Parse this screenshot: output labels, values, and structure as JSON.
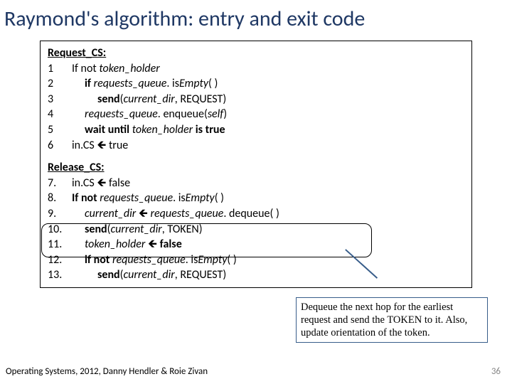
{
  "title": "Raymond's algorithm: entry and exit code",
  "request": {
    "header": "Request_CS:",
    "lines": [
      {
        "num": "1",
        "indent": 1,
        "parts": [
          "If not ",
          [
            "it",
            "token_holder"
          ]
        ]
      },
      {
        "num": "2",
        "indent": 2,
        "parts": [
          [
            "b",
            "if "
          ],
          [
            "it",
            "requests_queue"
          ],
          [
            ".",
            "is"
          ],
          [
            "it",
            "Empty"
          ],
          "( )"
        ]
      },
      {
        "num": "3",
        "indent": 3,
        "parts": [
          [
            "b",
            "send"
          ],
          "(",
          [
            "it",
            "current_dir"
          ],
          ", REQUEST)"
        ]
      },
      {
        "num": "4",
        "indent": 2,
        "parts": [
          [
            "it",
            "requests_queue"
          ],
          [
            ".",
            "enqueue"
          ],
          "(",
          [
            "it",
            "self"
          ],
          ")"
        ]
      },
      {
        "num": "5",
        "indent": 2,
        "parts": [
          [
            "b",
            "wait until "
          ],
          [
            "it",
            "token_holder"
          ],
          [
            "b",
            " is true"
          ]
        ]
      },
      {
        "num": "6",
        "indent": 1,
        "parts": [
          "in.CS ",
          [
            "arrow",
            "🡸"
          ],
          " true"
        ]
      }
    ]
  },
  "release": {
    "header": "Release_CS:",
    "lines": [
      {
        "num": "7.",
        "indent": 1,
        "parts": [
          "in.CS ",
          [
            "arrow",
            "🡸"
          ],
          " false"
        ]
      },
      {
        "num": "8.",
        "indent": 1,
        "parts": [
          [
            "b",
            "If not "
          ],
          [
            "it",
            "requests_queue"
          ],
          [
            ".",
            "is"
          ],
          [
            "it",
            "Empty"
          ],
          "( )"
        ]
      },
      {
        "num": "9.",
        "indent": 2,
        "parts": [
          [
            "it",
            "current_dir"
          ],
          " ",
          [
            "arrow",
            "🡸"
          ],
          " ",
          [
            "it",
            "requests_queue"
          ],
          [
            ".",
            "dequeue"
          ],
          "( )"
        ]
      },
      {
        "num": "10.",
        "indent": 2,
        "parts": [
          [
            "b",
            "send"
          ],
          "(",
          [
            "it",
            "current_dir"
          ],
          ", TOKEN)"
        ]
      },
      {
        "num": "11.",
        "indent": 2,
        "parts": [
          [
            "it",
            "token_holder"
          ],
          " ",
          [
            "arrow",
            "🡸"
          ],
          " ",
          [
            "b",
            "false"
          ]
        ]
      },
      {
        "num": "12.",
        "indent": 2,
        "parts": [
          [
            "b",
            "if not "
          ],
          [
            "it",
            "requests_queue"
          ],
          [
            ".",
            "is"
          ],
          [
            "it",
            "Empty"
          ],
          "( )"
        ]
      },
      {
        "num": "13.",
        "indent": 3,
        "parts": [
          [
            "b",
            "send"
          ],
          "(",
          [
            "it",
            "current_dir"
          ],
          ", REQUEST)"
        ]
      }
    ]
  },
  "callout": "Dequeue the next hop for the earliest request and send the TOKEN to it. Also, update orientation of the token.",
  "footer": "Operating Systems, 2012, Danny Hendler & Roie Zivan",
  "pagenum": "36"
}
